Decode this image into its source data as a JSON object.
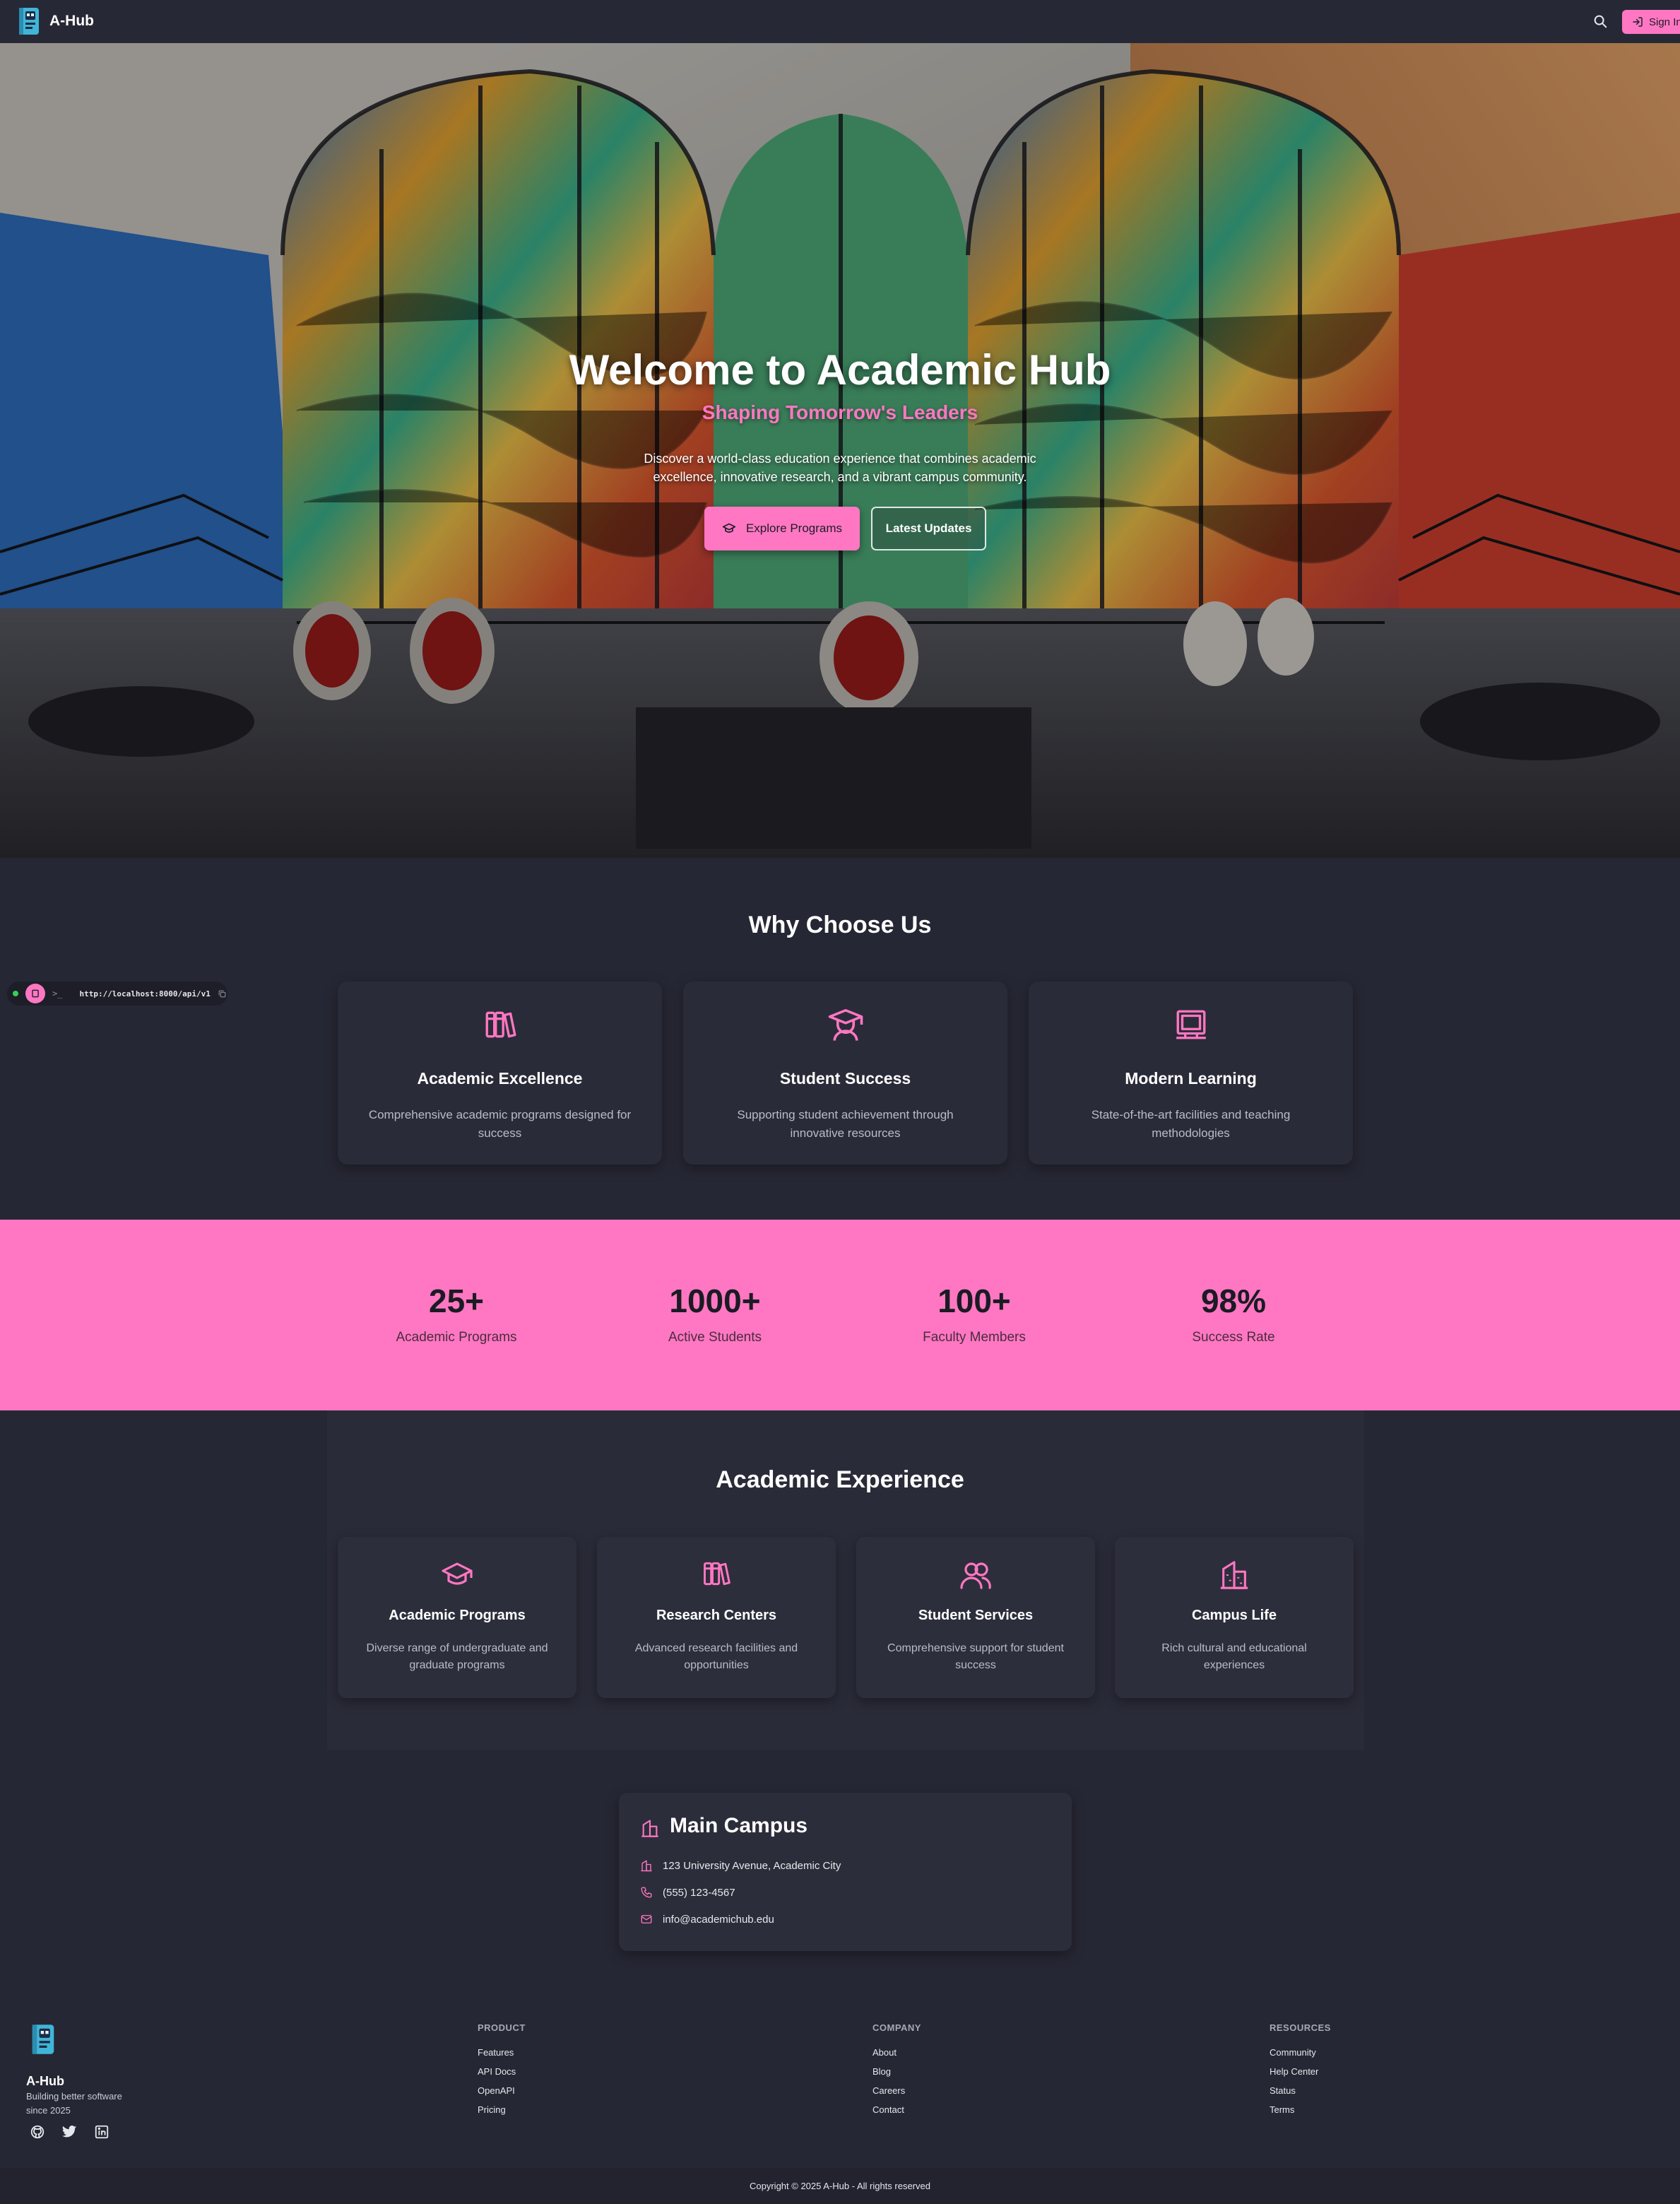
{
  "header": {
    "brand": "A-Hub",
    "signin_label": "Sign In",
    "icons": [
      "logo-icon",
      "search-icon",
      "sign-in-icon"
    ]
  },
  "hero": {
    "title": "Welcome to Academic Hub",
    "subtitle": "Shaping Tomorrow's Leaders",
    "description": "Discover a world-class education experience that combines academic excellence, innovative research, and a vibrant campus community.",
    "primary_button": "Explore Programs",
    "secondary_button": "Latest Updates"
  },
  "api_indicator": {
    "prompt": ">_",
    "url": "http://localhost:8000/api/v1"
  },
  "why": {
    "title": "Why Choose Us",
    "cards": [
      {
        "title": "Academic Excellence",
        "description": "Comprehensive academic programs designed for success",
        "icon": "books-icon"
      },
      {
        "title": "Student Success",
        "description": "Supporting student achievement through innovative resources",
        "icon": "graduate-icon"
      },
      {
        "title": "Modern Learning",
        "description": "State-of-the-art facilities and teaching methodologies",
        "icon": "presentation-board-icon"
      }
    ]
  },
  "stats": [
    {
      "value": "25+",
      "label": "Academic Programs"
    },
    {
      "value": "1000+",
      "label": "Active Students"
    },
    {
      "value": "100+",
      "label": "Faculty Members"
    },
    {
      "value": "98%",
      "label": "Success Rate"
    }
  ],
  "experience": {
    "title": "Academic Experience",
    "cards": [
      {
        "title": "Academic Programs",
        "description": "Diverse range of undergraduate and graduate programs",
        "icon": "mortarboard-icon"
      },
      {
        "title": "Research Centers",
        "description": "Advanced research facilities and opportunities",
        "icon": "books-icon"
      },
      {
        "title": "Student Services",
        "description": "Comprehensive support for student success",
        "icon": "users-icon"
      },
      {
        "title": "Campus Life",
        "description": "Rich cultural and educational experiences",
        "icon": "buildings-icon"
      }
    ]
  },
  "campus": {
    "title": "Main Campus",
    "address": "123 University Avenue, Academic City",
    "phone": "(555) 123-4567",
    "email": "info@academichub.edu"
  },
  "footer": {
    "brand": "A-Hub",
    "tagline": "Building better software since 2025",
    "columns": [
      {
        "heading": "PRODUCT",
        "links": [
          "Features",
          "API Docs",
          "OpenAPI",
          "Pricing"
        ]
      },
      {
        "heading": "COMPANY",
        "links": [
          "About",
          "Blog",
          "Careers",
          "Contact"
        ]
      },
      {
        "heading": "RESOURCES",
        "links": [
          "Community",
          "Help Center",
          "Status",
          "Terms"
        ]
      }
    ],
    "social_icons": [
      "github-icon",
      "twitter-icon",
      "linkedin-icon"
    ],
    "copyright": "Copyright © 2025 A-Hub - All rights reserved"
  },
  "colors": {
    "accent": "#ff77c2",
    "background": "#262734",
    "card": "#2a2b38",
    "text": "#ffffff"
  }
}
